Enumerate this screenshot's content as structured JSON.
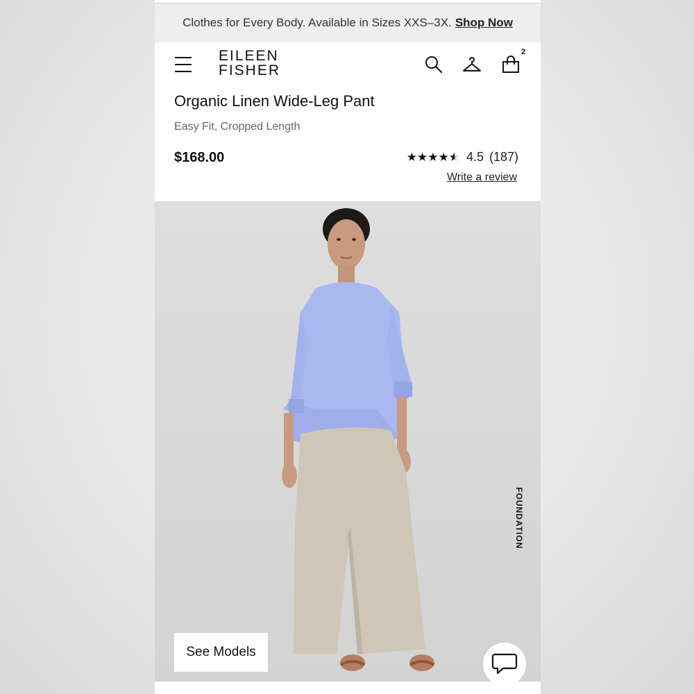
{
  "promo": {
    "text": "Clothes for Every Body. Available in Sizes XXS–3X.",
    "link": "Shop Now"
  },
  "header": {
    "brand_line1": "EILEEN",
    "brand_line2": "FISHER",
    "cart_count": "2",
    "icons": [
      "menu-icon",
      "search-icon",
      "account-hanger-icon",
      "shopping-bag-icon"
    ]
  },
  "product": {
    "title": "Organic Linen Wide-Leg Pant",
    "subtitle": "Easy Fit, Cropped Length",
    "price": "$168.00",
    "rating": {
      "stars": 4.5,
      "score": "4.5",
      "count": "(187)"
    },
    "write_review": "Write a review"
  },
  "gallery": {
    "side_label": "FOUNDATION",
    "see_models": "See Models",
    "chat_icon": "chat-bubble-icon"
  },
  "colors": {
    "sweater": "#aab8f0",
    "pants": "#cfc6b8",
    "background": "#d9d9d9"
  }
}
